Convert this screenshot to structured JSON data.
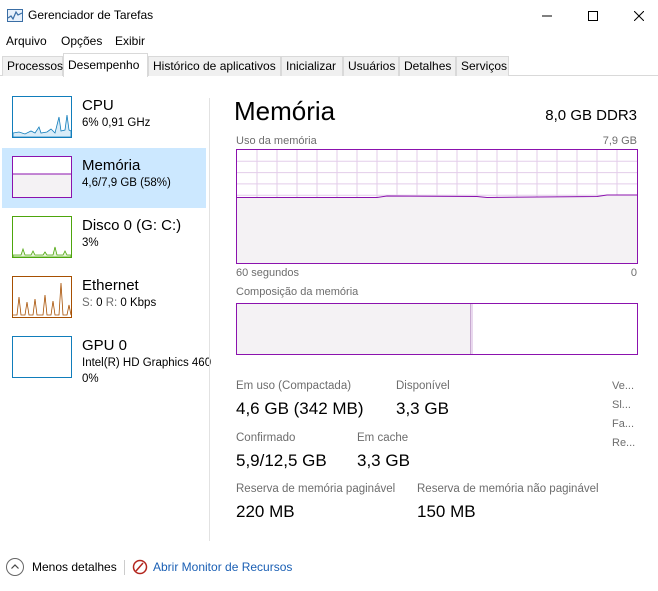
{
  "window": {
    "title": "Gerenciador de Tarefas"
  },
  "menu": [
    "Arquivo",
    "Opções",
    "Exibir"
  ],
  "tabs": [
    "Processos",
    "Desempenho",
    "Histórico de aplicativos",
    "Inicializar",
    "Usuários",
    "Detalhes",
    "Serviços"
  ],
  "active_tab": "Desempenho",
  "sidebar": {
    "items": [
      {
        "title": "CPU",
        "line1": "6% 0,91 GHz",
        "line2": ""
      },
      {
        "title": "Memória",
        "line1": "4,6/7,9 GB (58%)",
        "line2": ""
      },
      {
        "title": "Disco 0 (G: C:)",
        "line1": "3%",
        "line2": ""
      },
      {
        "title": "Ethernet",
        "line1_s": "S:",
        "line1_sv": "0",
        "line1_r": "R:",
        "line1_rv": "0 Kbps"
      },
      {
        "title": "GPU 0",
        "line1": "Intel(R) HD Graphics 460",
        "line2": "0%"
      }
    ]
  },
  "main": {
    "title": "Memória",
    "spec": "8,0 GB DDR3",
    "usage_label": "Uso da memória",
    "usage_max": "7,9 GB",
    "time_left": "60 segundos",
    "time_right": "0",
    "usage_fraction": 0.58,
    "composition_label": "Composição da memória",
    "stats": {
      "in_use_label": "Em uso (Compactada)",
      "in_use_value": "4,6 GB (342 MB)",
      "available_label": "Disponível",
      "available_value": "3,3 GB",
      "committed_label": "Confirmado",
      "committed_value": "5,9/12,5 GB",
      "cached_label": "Em cache",
      "cached_value": "3,3 GB",
      "paged_label": "Reserva de memória paginável",
      "paged_value": "220 MB",
      "nonpaged_label": "Reserva de memória não paginável",
      "nonpaged_value": "150 MB"
    },
    "side_notes": [
      "Ve...",
      "Sl...",
      "Fa...",
      "Re..."
    ]
  },
  "footer": {
    "fewer_details": "Menos detalhes",
    "resource_monitor": "Abrir Monitor de Recursos"
  },
  "colors": {
    "cpu": "#117dbb",
    "memory": "#8b12ae",
    "disk": "#4da60c",
    "ethernet": "#a74f01",
    "gpu": "#117dbb",
    "selected": "#cce8ff",
    "link": "#1a5fb4"
  }
}
